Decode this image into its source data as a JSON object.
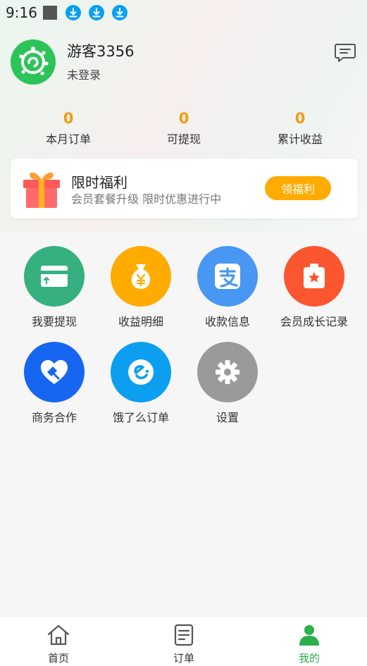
{
  "status_bar": {
    "time": "9:16",
    "notification_icons": [
      "download-icon",
      "download-icon",
      "download-icon"
    ]
  },
  "profile": {
    "username": "游客3356",
    "login_status": "未登录",
    "avatar_color": "#2cc458"
  },
  "stats": [
    {
      "value": "0",
      "label": "本月订单"
    },
    {
      "value": "0",
      "label": "可提现"
    },
    {
      "value": "0",
      "label": "累计收益"
    }
  ],
  "banner": {
    "title": "限时福利",
    "subtitle": "会员套餐升级 限时优惠进行中",
    "button_label": "领福利",
    "button_color": "#ffab00"
  },
  "grid": [
    {
      "label": "我要提现",
      "icon": "card-icon",
      "color": "#35b07e"
    },
    {
      "label": "收益明细",
      "icon": "money-bag-icon",
      "color": "#ffab00"
    },
    {
      "label": "收款信息",
      "icon": "alipay-icon",
      "color": "#4897f2"
    },
    {
      "label": "会员成长记录",
      "icon": "badge-icon",
      "color": "#fb5630"
    },
    {
      "label": "商务合作",
      "icon": "handshake-heart-icon",
      "color": "#1766f2"
    },
    {
      "label": "饿了么订单",
      "icon": "eleme-icon",
      "color": "#0c9ff0"
    },
    {
      "label": "设置",
      "icon": "gear-icon",
      "color": "#9a9a9a"
    }
  ],
  "tabs": [
    {
      "label": "首页",
      "icon": "home-icon"
    },
    {
      "label": "订单",
      "icon": "list-icon"
    },
    {
      "label": "我的",
      "icon": "user-icon",
      "active": true
    }
  ],
  "colors": {
    "accent_green": "#2bb04a",
    "stat_orange": "#f59a10"
  }
}
